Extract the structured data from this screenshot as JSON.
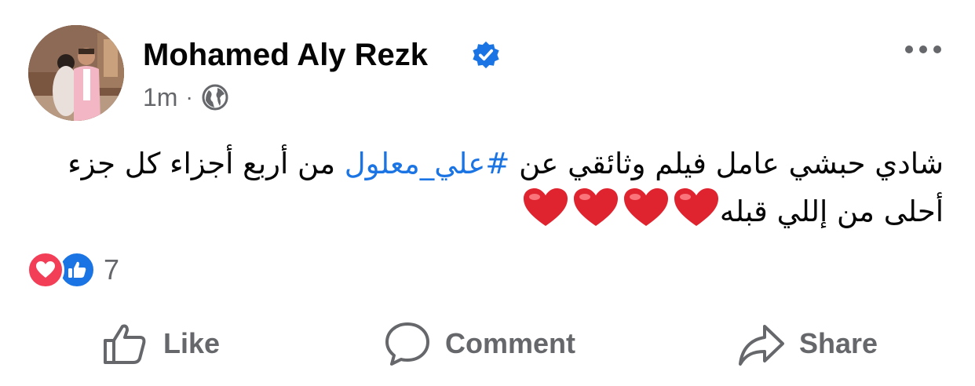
{
  "post": {
    "author": "Mohamed Aly Rezk",
    "time": "1m",
    "meta_separator": "·",
    "text_before": "شادي حبشي عامل فيلم وثائقي عن ",
    "hashtag": "#علي_معلول",
    "text_after": " من أربع أجزاء كل جزء أحلى من إللي قبله",
    "emoji_count": 4
  },
  "reactions": {
    "count": "7",
    "types": [
      "love",
      "like"
    ]
  },
  "actions": {
    "like": "Like",
    "comment": "Comment",
    "share": "Share"
  },
  "colors": {
    "link": "#1b74e4",
    "secondary": "#65676b",
    "love": "#f33e58",
    "like": "#1b74e4",
    "heart": "#e0242f"
  },
  "icons": [
    "verified-badge-icon",
    "more-options-icon",
    "globe-icon",
    "heart-emoji-icon",
    "love-reaction-icon",
    "like-reaction-icon",
    "thumbs-up-icon",
    "comment-bubble-icon",
    "share-arrow-icon"
  ]
}
